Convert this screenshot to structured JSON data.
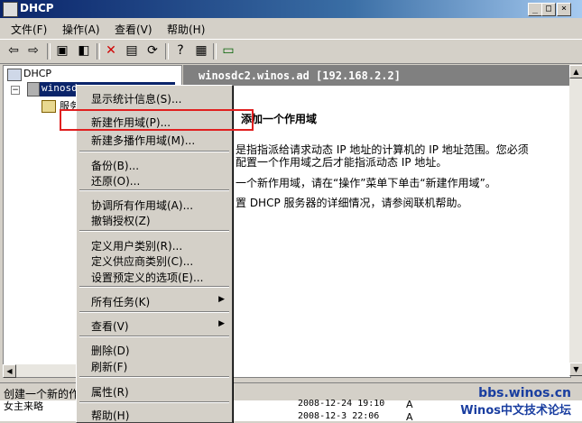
{
  "window": {
    "title": "DHCP",
    "buttons": [
      "_",
      "□",
      "×"
    ]
  },
  "menubar": [
    "文件(F)",
    "操作(A)",
    "查看(V)",
    "帮助(H)"
  ],
  "tree": {
    "root": "DHCP",
    "server": "winosdc2.winos.ad [192.168.2.2]",
    "server_visible": "winosdc",
    "child": "服务"
  },
  "right": {
    "header": "winosdc2.winos.ad [192.168.2.2]",
    "heading": "添加一个作用域",
    "line1": "是指指派给请求动态 IP 地址的计算机的 IP 地址范围。您必须",
    "line2": "配置一个作用域之后才能指派动态 IP 地址。",
    "line3": "一个新作用域，请在“操作”菜单下单击“新建作用域”。",
    "line4": "置 DHCP 服务器的详细情况，请参阅联机帮助。"
  },
  "context_menu": {
    "items": [
      "显示统计信息(S)...",
      "新建作用域(P)...",
      "新建多播作用域(M)...",
      "备份(B)...",
      "还原(O)...",
      "协调所有作用域(A)...",
      "撤销授权(Z)",
      "定义用户类别(R)...",
      "定义供应商类别(C)...",
      "设置预定义的选项(E)...",
      "所有任务(K)",
      "查看(V)",
      "删除(D)",
      "刷新(F)",
      "属性(R)",
      "帮助(H)"
    ]
  },
  "statusbar": {
    "text": "创建一个新的作"
  },
  "bottom": {
    "left": "女主来略",
    "row1_date": "2008-12-24 19:10",
    "row1_flag": "A",
    "row2_date": "2008-12-3 22:06",
    "row2_flag": "A"
  },
  "watermark": {
    "line1": "bbs.winos.cn",
    "line2": "Winos中文技术论坛"
  }
}
